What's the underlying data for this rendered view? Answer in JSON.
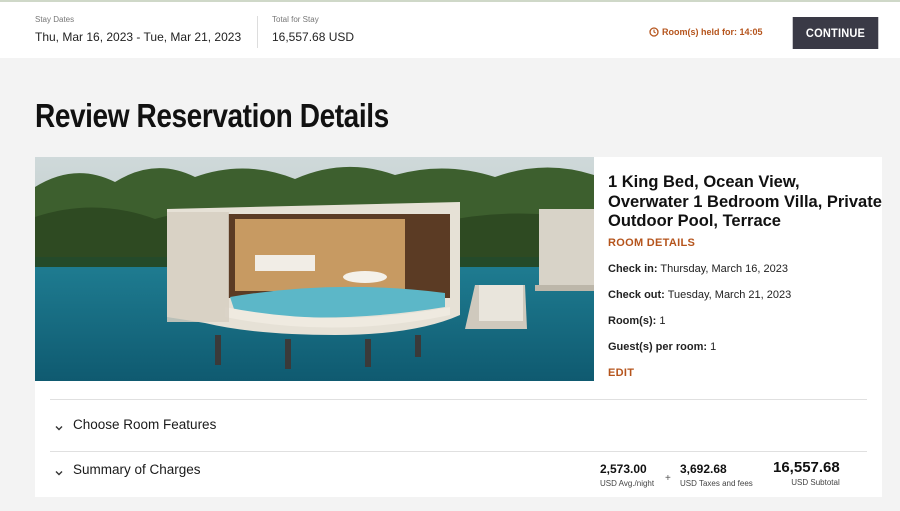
{
  "header": {
    "stay_dates_caption": "Stay Dates",
    "stay_dates_value": "Thu, Mar 16, 2023 - Tue, Mar 21, 2023",
    "total_caption": "Total for Stay",
    "total_value": "16,557.68 USD",
    "held_text": "Room(s) held for: 14:05",
    "continue_label": "CONTINUE"
  },
  "page_title": "Review Reservation Details",
  "room": {
    "name": "1 King Bed, Ocean View, Overwater 1 Bedroom Villa, Private Outdoor Pool, Terrace",
    "details_link": "ROOM DETAILS",
    "check_in_label": "Check in:",
    "check_in_value": "Thursday, March 16, 2023",
    "check_out_label": "Check out:",
    "check_out_value": "Tuesday, March 21, 2023",
    "rooms_label": "Room(s):",
    "rooms_value": "1",
    "guests_label": "Guest(s) per room:",
    "guests_value": "1",
    "edit_link": "EDIT"
  },
  "sections": {
    "features_label": "Choose Room Features",
    "charges_label": "Summary of Charges"
  },
  "charges": {
    "avg_amount": "2,573.00",
    "avg_caption": "USD Avg./night",
    "plus": "+",
    "taxes_amount": "3,692.68",
    "taxes_caption": "USD Taxes and fees",
    "subtotal_amount": "16,557.68",
    "subtotal_caption": "USD Subtotal"
  },
  "colors": {
    "accent": "#b5541c",
    "button": "#3a3a46",
    "background": "#f3f3f3"
  },
  "icons": {
    "timer": "clock-icon",
    "accordion": "chevron-down-icon"
  }
}
